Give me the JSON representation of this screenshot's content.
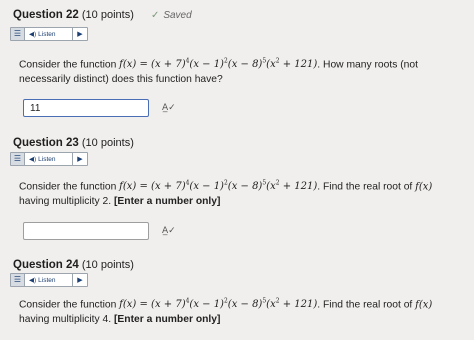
{
  "listen_label": "Listen",
  "q22": {
    "title": "Question 22",
    "points": "(10 points)",
    "saved": "Saved",
    "text_before": "Consider the function ",
    "text_after": ". How many roots (not necessarily distinct) does this function have?",
    "answer": "11"
  },
  "q23": {
    "title": "Question 23",
    "points": "(10 points)",
    "text_before": "Consider the function ",
    "text_after_1": ". Find the real root of ",
    "text_after_2": " having multiplicity 2. ",
    "bold": "[Enter a number only]",
    "answer": ""
  },
  "q24": {
    "title": "Question 24",
    "points": "(10 points)",
    "text_before": "Consider the function ",
    "text_after_1": ". Find the real root of ",
    "text_after_2": " having multiplicity 4. ",
    "bold": "[Enter a number only]"
  }
}
